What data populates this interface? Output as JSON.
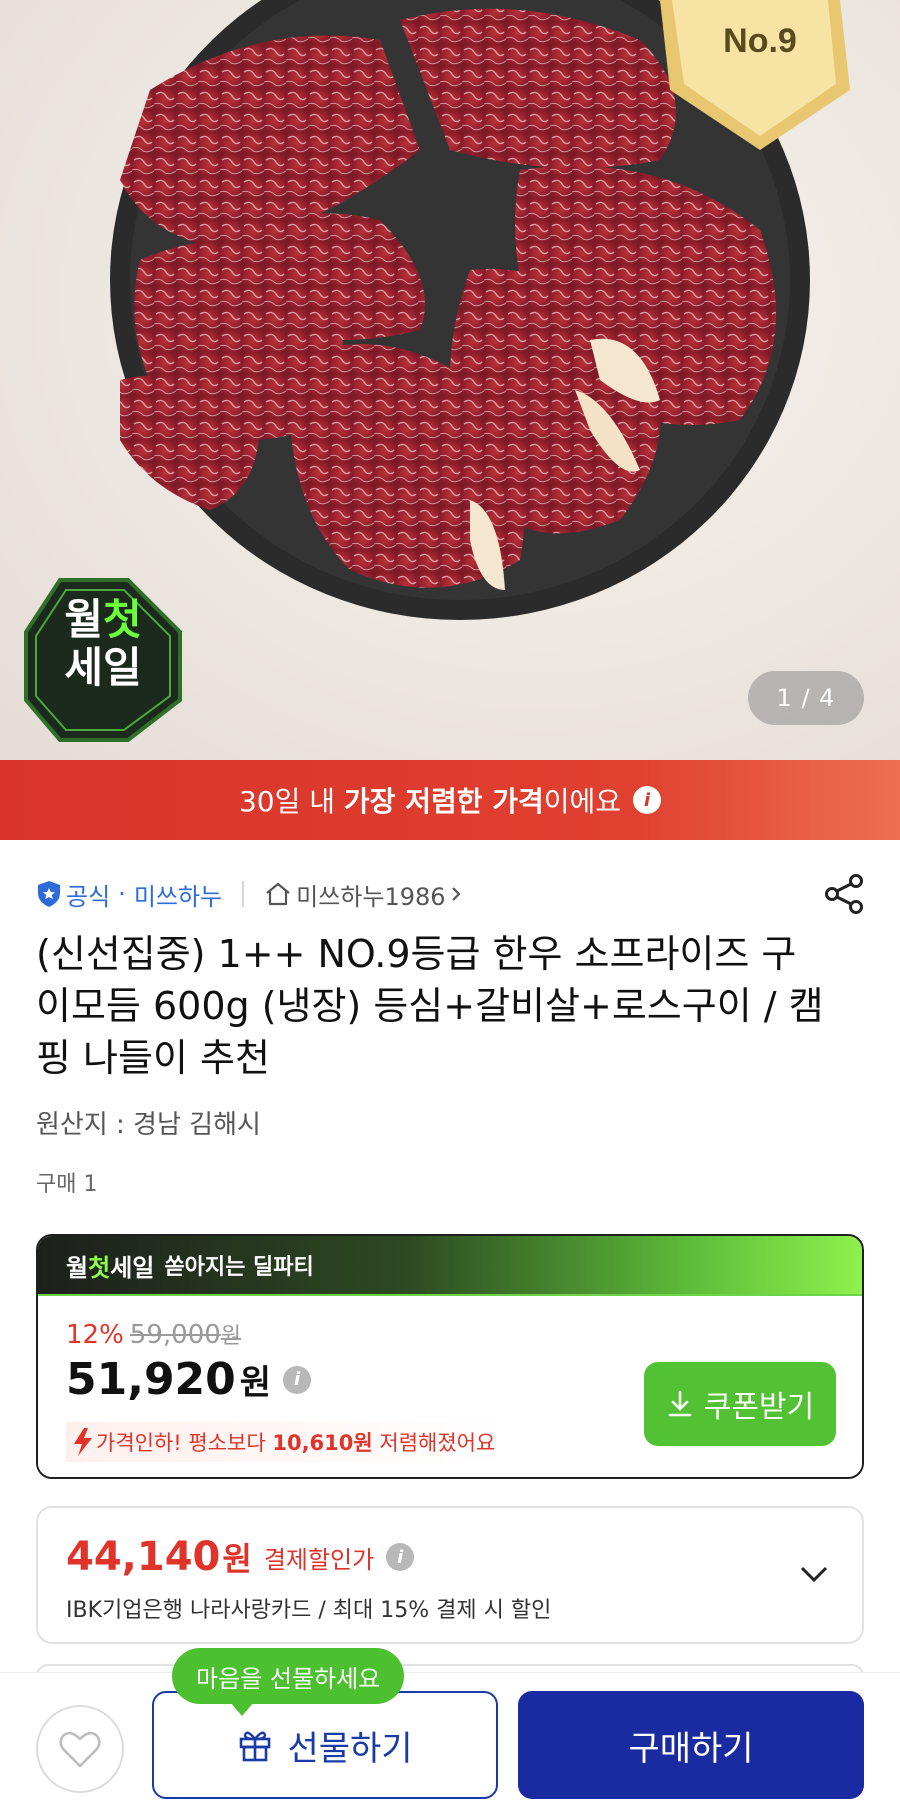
{
  "hero": {
    "counter": "1 / 4",
    "grade_badge": "No.9",
    "sale_badge_line1_a": "월",
    "sale_badge_line1_b": "첫",
    "sale_badge_line2": "세일"
  },
  "lowest_banner": {
    "prefix": "30일 내 ",
    "bold": "가장 저렴한 가격",
    "suffix": "이에요"
  },
  "seller": {
    "official_label": "공식",
    "brand_name": "미쓰하누",
    "store_name": "미쓰하누1986"
  },
  "product": {
    "title": "(신선집중) 1++ NO.9등급 한우 소프라이즈 구이모듬 600g (냉장) 등심+갈비살+로스구이 / 캠핑 나들이 추천",
    "origin": "원산지 : 경남 김해시",
    "purchases": "구매 1"
  },
  "deal": {
    "tag_a": "월",
    "tag_b": "첫",
    "tag_c": "세일",
    "headline": "쏟아지는 딜파티",
    "discount_pct": "12%",
    "original_price": "59,000",
    "original_won": "원",
    "sale_price": "51,920",
    "sale_won": "원",
    "drop_prefix": "가격인하! 평소보다 ",
    "drop_amount": "10,610원",
    "drop_suffix": " 저렴해졌어요",
    "coupon_label": "쿠폰받기"
  },
  "card_discount": {
    "amount": "44,140",
    "won": "원",
    "label": "결제할인가",
    "description": "IBK기업은행 나라사랑카드 / 최대 15% 결제 시 할인"
  },
  "bottom": {
    "tooltip": "마음을 선물하세요",
    "gift_label": "선물하기",
    "buy_label": "구매하기"
  },
  "colors": {
    "accent_red": "#e0342b",
    "brand_blue": "#1a2aa0",
    "deal_green": "#52c234",
    "official_blue": "#2d6bd9"
  }
}
